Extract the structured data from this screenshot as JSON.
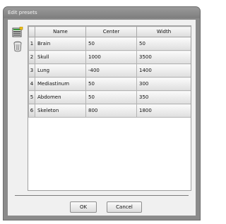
{
  "window": {
    "title": "Edit presets"
  },
  "toolbar": {
    "items": [
      {
        "icon": "list-edit-icon"
      },
      {
        "icon": "trash-icon"
      }
    ]
  },
  "grid": {
    "columns": [
      "Name",
      "Center",
      "Width"
    ],
    "rows": [
      {
        "num": "1",
        "name": "Brain",
        "center": "50",
        "width": "50"
      },
      {
        "num": "2",
        "name": "Skull",
        "center": "1000",
        "width": "3500"
      },
      {
        "num": "3",
        "name": "Lung",
        "center": "-400",
        "width": "1400"
      },
      {
        "num": "4",
        "name": "Mediastinum",
        "center": "50",
        "width": "300"
      },
      {
        "num": "5",
        "name": "Abdomen",
        "center": "50",
        "width": "350"
      },
      {
        "num": "6",
        "name": "Skeleton",
        "center": "800",
        "width": "1800"
      }
    ]
  },
  "footer": {
    "ok_label": "OK",
    "cancel_label": "Cancel"
  }
}
